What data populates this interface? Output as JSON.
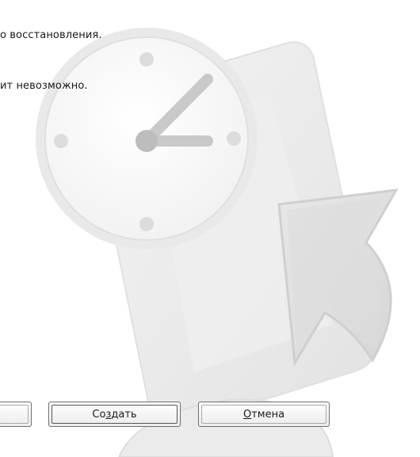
{
  "dialog": {
    "text_line_1": "о восстановления.",
    "text_line_2": "ит невозможно."
  },
  "buttons": {
    "create": {
      "before": "Со",
      "mnemonic": "з",
      "after": "дать"
    },
    "cancel": {
      "mnemonic": "О",
      "after": "тмена"
    }
  },
  "watermark": {
    "icon": "system-restore-clock-icon",
    "colors": {
      "light": "#ececec",
      "mid": "#dedede",
      "dark": "#c4c4c4"
    }
  }
}
